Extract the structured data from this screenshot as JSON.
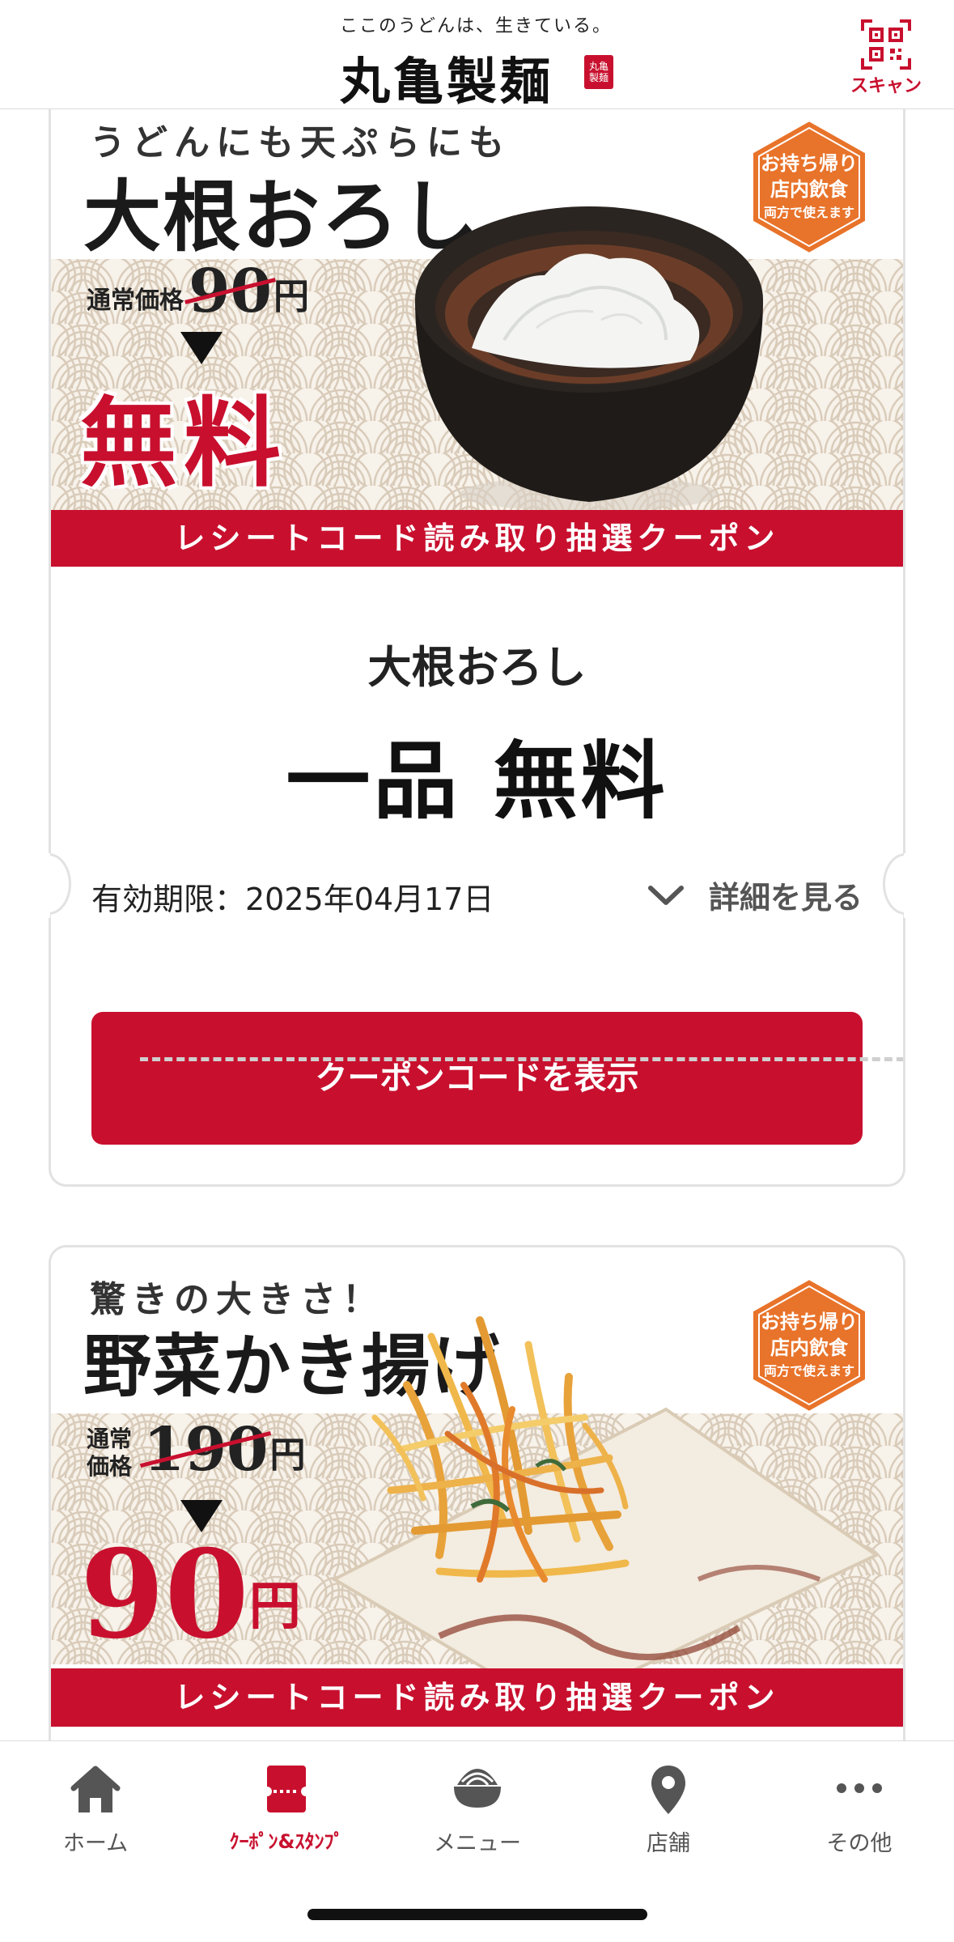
{
  "header": {
    "tagline": "ここのうどんは、生きている。",
    "brand": "丸亀製麺",
    "seal": "丸亀製麺",
    "scan_label": "スキャン"
  },
  "coupons": [
    {
      "catch_copy": "うどんにも天ぷらにも",
      "big_title": "大根おろし",
      "normal_price_label": "通常価格",
      "normal_price": "90",
      "yen": "円",
      "promo": "無料",
      "badge": [
        "お持ち帰り",
        "店内飲食",
        "両方で使えます"
      ],
      "ribbon": "レシートコード読み取り抽選クーポン",
      "item_name": "大根おろし",
      "offer": "一品 無料",
      "expiry": "有効期限：2025年04月17日",
      "details_label": "詳細を見る",
      "button_label": "クーポンコードを表示"
    },
    {
      "catch_copy": "驚きの大きさ！",
      "big_title": "野菜かき揚げ",
      "normal_price_label": "通常価格",
      "normal_price": "190",
      "yen": "円",
      "promo_price": "90",
      "badge": [
        "お持ち帰り",
        "店内飲食",
        "両方で使えます"
      ],
      "ribbon": "レシートコード読み取り抽選クーポン"
    }
  ],
  "tabbar": {
    "items": [
      {
        "label": "ホーム",
        "icon": "home-icon"
      },
      {
        "label": "ｸｰﾎﾟﾝ&ｽﾀﾝﾌﾟ",
        "icon": "coupon-icon",
        "active": true
      },
      {
        "label": "メニュー",
        "icon": "menu-bowl-icon"
      },
      {
        "label": "店舗",
        "icon": "location-pin-icon"
      },
      {
        "label": "その他",
        "icon": "more-dots-icon"
      }
    ]
  },
  "colors": {
    "brand_red": "#c8102e",
    "badge_orange": "#e8732a"
  }
}
